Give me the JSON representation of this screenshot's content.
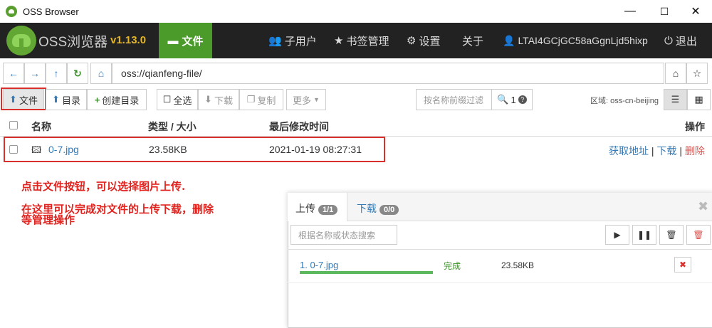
{
  "window": {
    "title": "OSS Browser",
    "minimize": "—",
    "maximize": "☐",
    "close": "✕"
  },
  "nav": {
    "brand": "OSS浏览器",
    "version": "v1.13.0",
    "active_tab": "文件",
    "sub_users": "子用户",
    "bookmarks": "书签管理",
    "settings": "设置",
    "about": "关于",
    "account": "LTAI4GCjGC58aGgnLjd5hixp",
    "logout": "退出"
  },
  "address": {
    "path": "oss://qianfeng-file/"
  },
  "toolbar": {
    "upload_file": "文件",
    "upload_dir": "目录",
    "create_dir": "创建目录",
    "select_all": "全选",
    "download": "下载",
    "copy": "复制",
    "more": "更多",
    "search_placeholder": "按名称前缀过滤",
    "search_count": "1",
    "region": "区域: oss-cn-beijing"
  },
  "table": {
    "headers": {
      "name": "名称",
      "type_size": "类型 / 大小",
      "modified": "最后修改时间",
      "actions": "操作"
    },
    "rows": [
      {
        "name": "0-7.jpg",
        "size": "23.58KB",
        "modified": "2021-01-19 08:27:31",
        "action_url": "获取地址",
        "action_download": "下载",
        "action_delete": "删除",
        "sep": "|"
      }
    ]
  },
  "annotation": {
    "line1": "点击文件按钮，可以选择图片上传.",
    "line2": "在这里可以完成对文件的上传下载，删除",
    "line3": "等管理操作"
  },
  "transfer": {
    "upload_tab": "上传",
    "upload_badge": "1/1",
    "download_tab": "下载",
    "download_badge": "0/0",
    "search_placeholder": "根据名称或状态搜索",
    "items": [
      {
        "name": "1. 0-7.jpg",
        "status": "完成",
        "size": "23.58KB",
        "progress": 1.0
      }
    ]
  },
  "colors": {
    "accent": "#4a9b2a",
    "link": "#337ab7",
    "annotation": "#e0231e",
    "version": "#e3b52a"
  }
}
